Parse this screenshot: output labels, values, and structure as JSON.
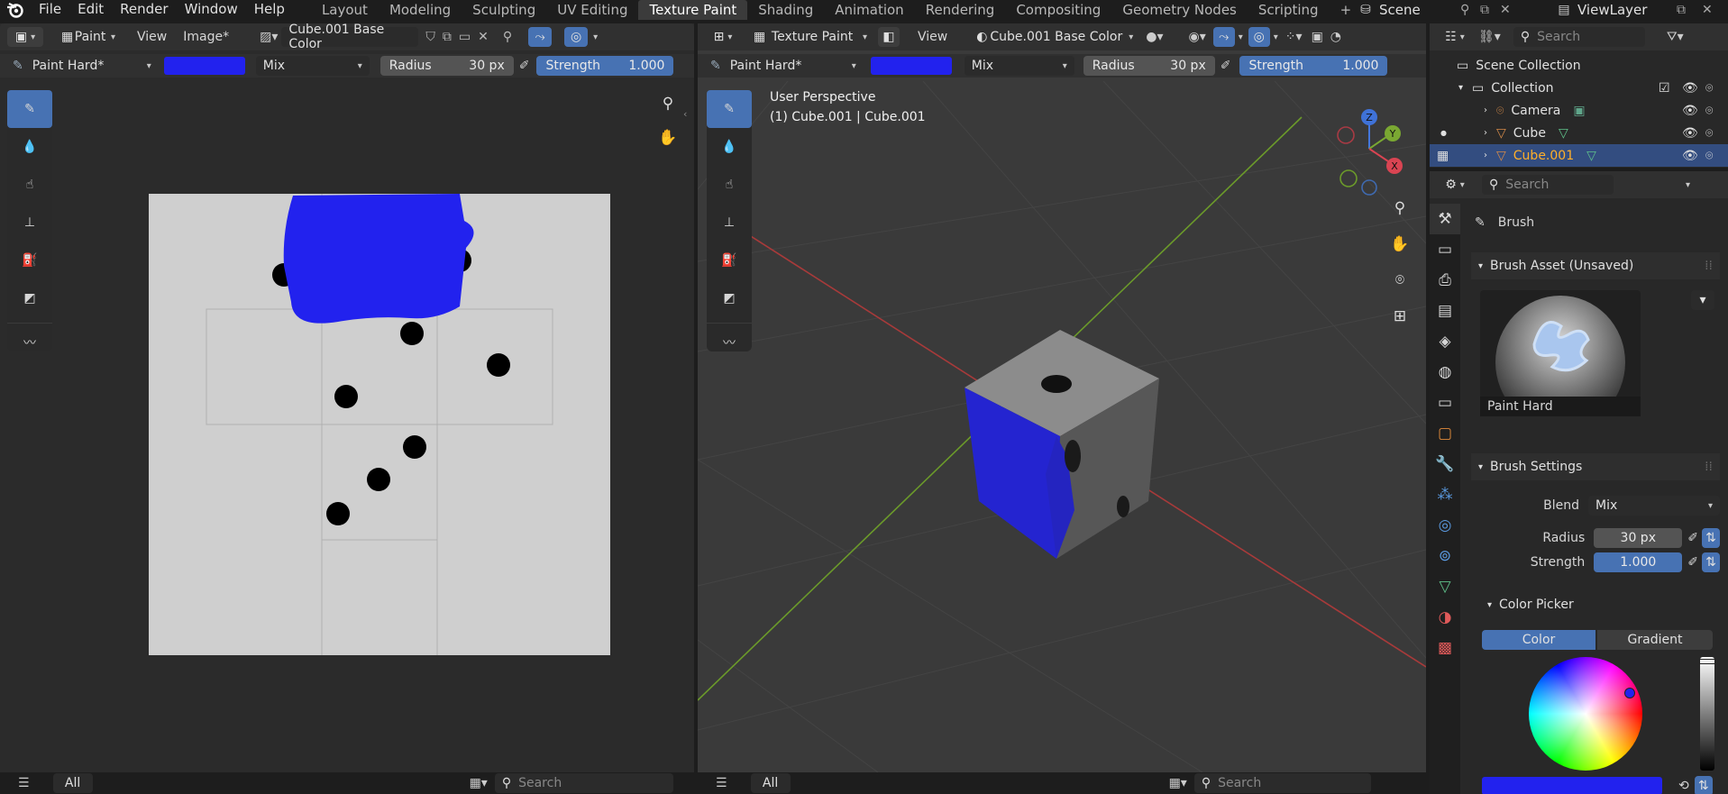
{
  "menu": [
    "File",
    "Edit",
    "Render",
    "Window",
    "Help"
  ],
  "workspaces": [
    "Layout",
    "Modeling",
    "Sculpting",
    "UV Editing",
    "Texture Paint",
    "Shading",
    "Animation",
    "Rendering",
    "Compositing",
    "Geometry Nodes",
    "Scripting"
  ],
  "active_workspace": "Texture Paint",
  "scene": "Scene",
  "view_layer": "ViewLayer",
  "image_editor": {
    "mode": "Paint",
    "menus": [
      "View",
      "Image*"
    ],
    "image_name": "Cube.001 Base Color",
    "brush": "Paint Hard*",
    "blend": "Mix",
    "radius_label": "Radius",
    "radius_value": "30 px",
    "strength_label": "Strength",
    "strength_value": "1.000",
    "footer_all": "All",
    "search_placeholder": "Search"
  },
  "viewport": {
    "mode": "Texture Paint",
    "view_menu": "View",
    "image_name": "Cube.001 Base Color",
    "brush": "Paint Hard*",
    "blend": "Mix",
    "radius_label": "Radius",
    "radius_value": "30 px",
    "strength_label": "Strength",
    "strength_value": "1.000",
    "perspective": "User Perspective",
    "object_info": "(1) Cube.001 | Cube.001",
    "gizmo": {
      "x": "X",
      "y": "Y",
      "z": "Z"
    },
    "footer_all": "All",
    "search_placeholder": "Search"
  },
  "outliner": {
    "search_placeholder": "Search",
    "root": "Scene Collection",
    "collection": "Collection",
    "objects": [
      "Camera",
      "Cube",
      "Cube.001"
    ],
    "selected": "Cube.001"
  },
  "properties": {
    "search_placeholder": "Search",
    "context_title": "Brush",
    "asset_panel": "Brush Asset (Unsaved)",
    "asset_name": "Paint Hard",
    "settings_panel": "Brush Settings",
    "blend_label": "Blend",
    "blend_value": "Mix",
    "radius_label": "Radius",
    "radius_value": "30 px",
    "strength_label": "Strength",
    "strength_value": "1.000",
    "color_picker": "Color Picker",
    "color_tab": "Color",
    "gradient_tab": "Gradient"
  },
  "colors": {
    "paint": "#2222ee",
    "accent": "#4772b3",
    "header": "#303030",
    "viewport_bg": "#3a3a3a"
  }
}
